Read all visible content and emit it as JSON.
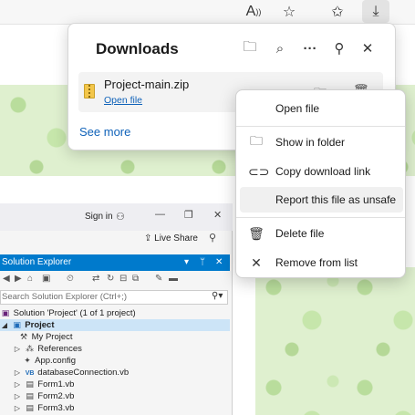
{
  "browser": {
    "toolbar": {
      "read_aloud_icon": "read-aloud-icon",
      "favorite_icon": "star-icon",
      "collections_icon": "favorites-list-icon",
      "downloads_icon": "download-icon"
    }
  },
  "downloads": {
    "title": "Downloads",
    "header_icons": [
      "folder-icon",
      "search-icon",
      "more-icon",
      "pin-icon",
      "close-icon"
    ],
    "item": {
      "filename": "Project-main.zip",
      "open_link": "Open file"
    },
    "see_more": "See more"
  },
  "context_menu": {
    "items": [
      {
        "label": "Open file",
        "icon": ""
      },
      {
        "label": "Show in folder",
        "icon": "folder-icon"
      },
      {
        "label": "Copy download link",
        "icon": "link-icon"
      },
      {
        "label": "Report this file as unsafe",
        "icon": ""
      },
      {
        "label": "Delete file",
        "icon": "trash-icon"
      },
      {
        "label": "Remove from list",
        "icon": "close-icon"
      }
    ]
  },
  "visual_studio": {
    "sign_in": "Sign in",
    "live_share": "Live Share",
    "solution_explorer": {
      "title": "Solution Explorer",
      "search_placeholder": "Search Solution Explorer (Ctrl+;)",
      "tree": [
        {
          "label": "Solution 'Project' (1 of 1 project)"
        },
        {
          "label": "Project"
        },
        {
          "label": "My Project"
        },
        {
          "label": "References"
        },
        {
          "label": "App.config"
        },
        {
          "label": "databaseConnection.vb"
        },
        {
          "label": "Form1.vb"
        },
        {
          "label": "Form2.vb"
        },
        {
          "label": "Form3.vb"
        }
      ]
    }
  },
  "colors": {
    "accent_blue": "#007acc",
    "link_blue": "#0f62b9",
    "page_green": "#dff0cf"
  }
}
